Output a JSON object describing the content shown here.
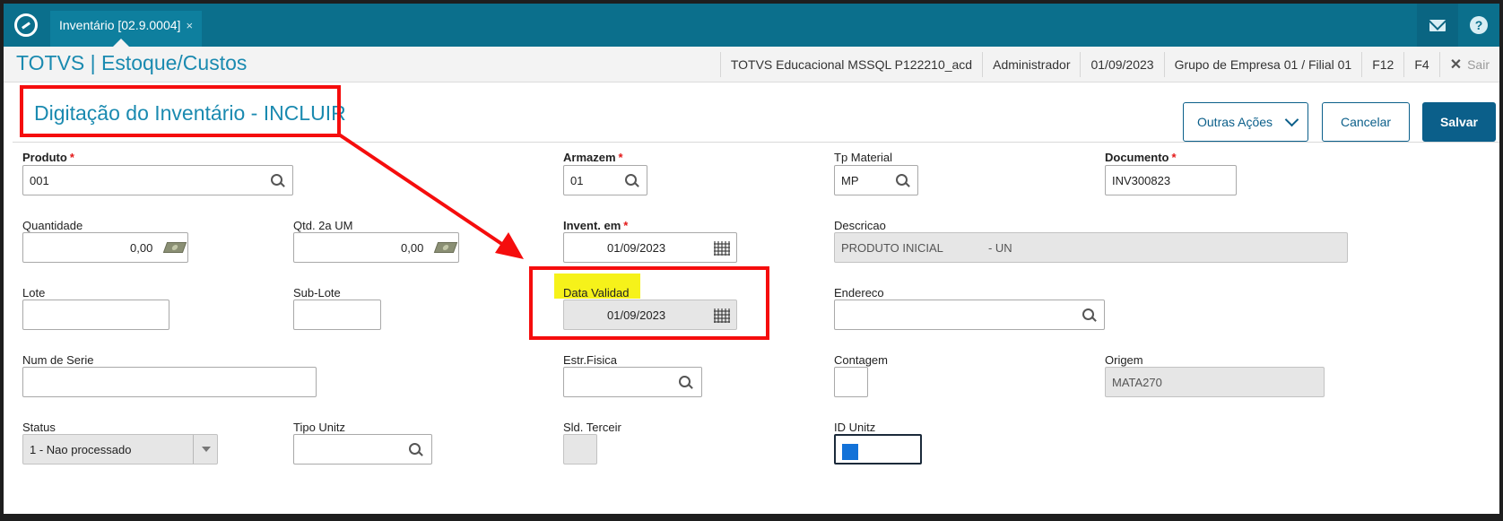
{
  "topbar": {
    "tab_label": "Inventário [02.9.0004]",
    "tab_close": "×"
  },
  "header": {
    "app_title": "TOTVS | Estoque/Custos",
    "environment": "TOTVS Educacional MSSQL P122210_acd",
    "user": "Administrador",
    "date": "01/09/2023",
    "company": "Grupo de Empresa 01 / Filial 01",
    "f12": "F12",
    "f4": "F4",
    "sair": "Sair"
  },
  "page": {
    "title": "Digitação do Inventário - INCLUIR",
    "buttons": {
      "outras": "Outras Ações",
      "cancelar": "Cancelar",
      "salvar": "Salvar"
    }
  },
  "required_mark": "*",
  "fields": {
    "produto": {
      "label": "Produto",
      "value": "001"
    },
    "armazem": {
      "label": "Armazem",
      "value": "01"
    },
    "tp_material": {
      "label": "Tp Material",
      "value": "MP"
    },
    "documento": {
      "label": "Documento",
      "value": "INV300823"
    },
    "quantidade": {
      "label": "Quantidade",
      "value": "0,00"
    },
    "qtd2": {
      "label": "Qtd. 2a UM",
      "value": "0,00"
    },
    "invent_em": {
      "label": "Invent. em",
      "value": "01/09/2023"
    },
    "descricao": {
      "label": "Descricao",
      "value": "PRODUTO INICIAL              - UN"
    },
    "lote": {
      "label": "Lote",
      "value": ""
    },
    "sublote": {
      "label": "Sub-Lote",
      "value": ""
    },
    "data_validad": {
      "label": "Data Validad",
      "value": "01/09/2023"
    },
    "endereco": {
      "label": "Endereco",
      "value": ""
    },
    "num_serie": {
      "label": "Num de Serie",
      "value": ""
    },
    "estr_fisica": {
      "label": "Estr.Fisica",
      "value": ""
    },
    "contagem": {
      "label": "Contagem",
      "value": ""
    },
    "origem": {
      "label": "Origem",
      "value": "MATA270"
    },
    "status": {
      "label": "Status",
      "value": "1 - Nao processado"
    },
    "tipo_unitz": {
      "label": "Tipo Unitz",
      "value": ""
    },
    "sld_terceir": {
      "label": "Sld. Terceir",
      "value": ""
    },
    "id_unitz": {
      "label": "ID Unitz",
      "value": ""
    }
  },
  "colors": {
    "topbar": "#0b6f8c",
    "title": "#1a8ab0",
    "primary_button": "#0b5f8a",
    "annotation_red": "#f50d0d",
    "highlight_yellow": "#f6f21a"
  }
}
